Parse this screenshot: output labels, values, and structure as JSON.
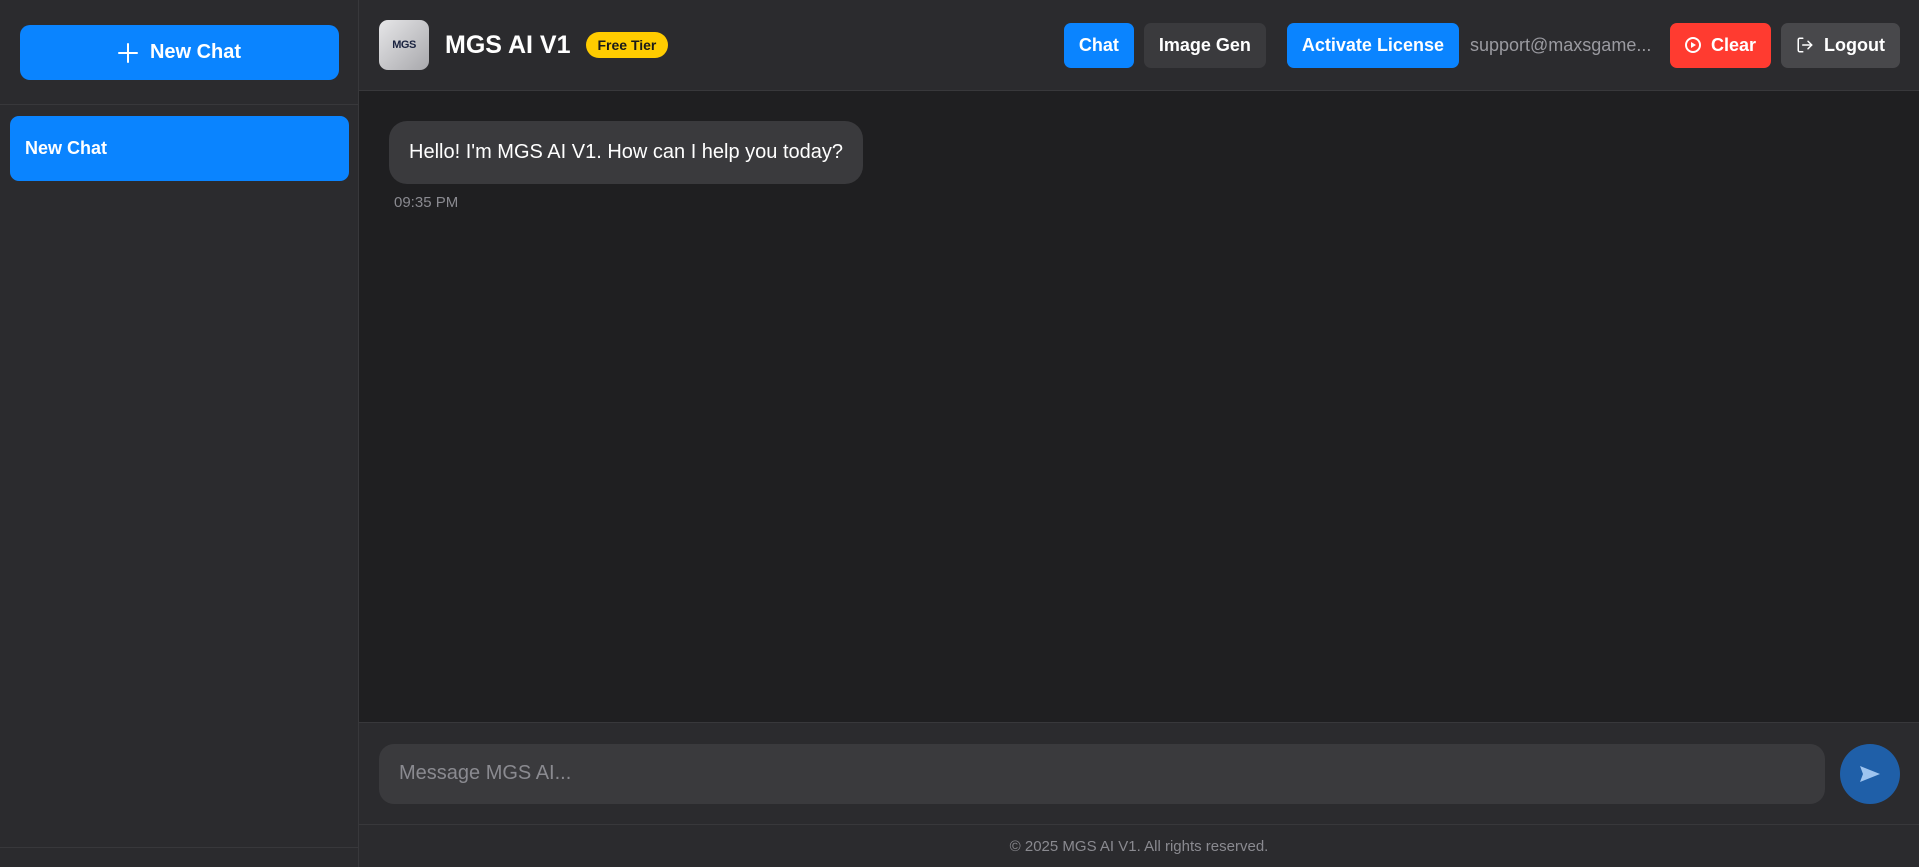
{
  "sidebar": {
    "new_chat_label": "New Chat",
    "new_chat_icon": "plus-icon",
    "chats": [
      {
        "label": "New Chat",
        "active": true
      }
    ]
  },
  "header": {
    "logo_text": "MGS",
    "title": "MGS AI V1",
    "tier_badge": "Free Tier",
    "buttons": {
      "chat": "Chat",
      "image_gen": "Image Gen",
      "activate_license": "Activate License",
      "clear": "Clear",
      "logout": "Logout"
    },
    "email": "support@maxsgame..."
  },
  "messages": [
    {
      "role": "assistant",
      "text": "Hello! I'm MGS AI V1. How can I help you today?",
      "time": "09:35 PM"
    }
  ],
  "composer": {
    "placeholder": "Message MGS AI...",
    "send_icon": "send-icon"
  },
  "footer": {
    "text": "© 2025 MGS AI V1. All rights reserved."
  },
  "colors": {
    "accent": "#0a84ff",
    "danger": "#ff3b30",
    "badge": "#ffcc00",
    "background": "#1f1f21",
    "panel": "#2b2b2e"
  }
}
